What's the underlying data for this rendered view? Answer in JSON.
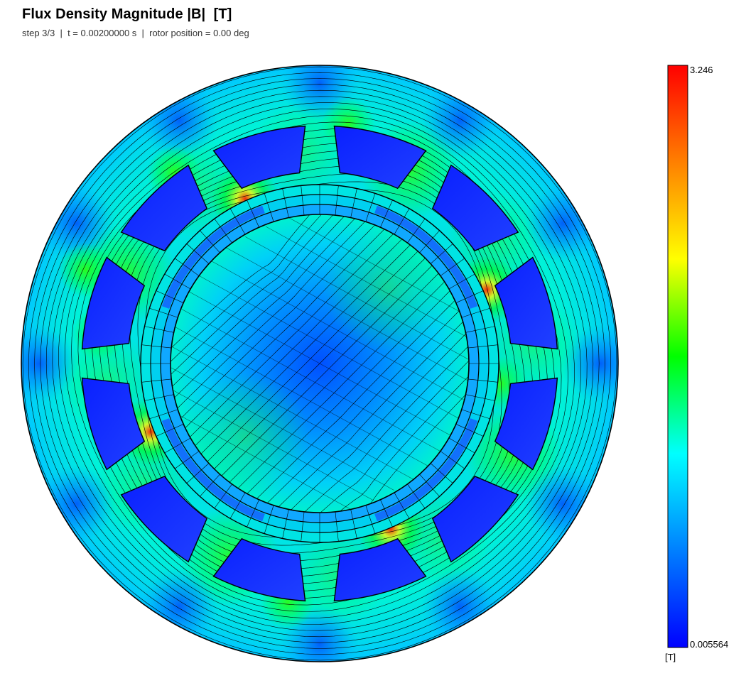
{
  "header": {
    "title": "Flux Density Magnitude |B|  [T]",
    "subtitle": "step 3/3  |  t = 0.00200000 s  |  rotor position = 0.00 deg"
  },
  "colorbar": {
    "max_label": "3.246",
    "min_label": "0.005564",
    "unit_label": "[T]",
    "stops": [
      "#0000ff",
      "#0080ff",
      "#00ffff",
      "#00ff00",
      "#ffff00",
      "#ff8000",
      "#ff0000"
    ]
  },
  "colors": {
    "background_field": "#00e6e6",
    "low_field": "#0a3cff",
    "slot": "#1a33ff",
    "high_field": "#00e600",
    "peak_field": "#ff2000",
    "flux_line": "#000000"
  },
  "model": {
    "stator_slots": 12,
    "rotor_ring_segments": 60
  }
}
